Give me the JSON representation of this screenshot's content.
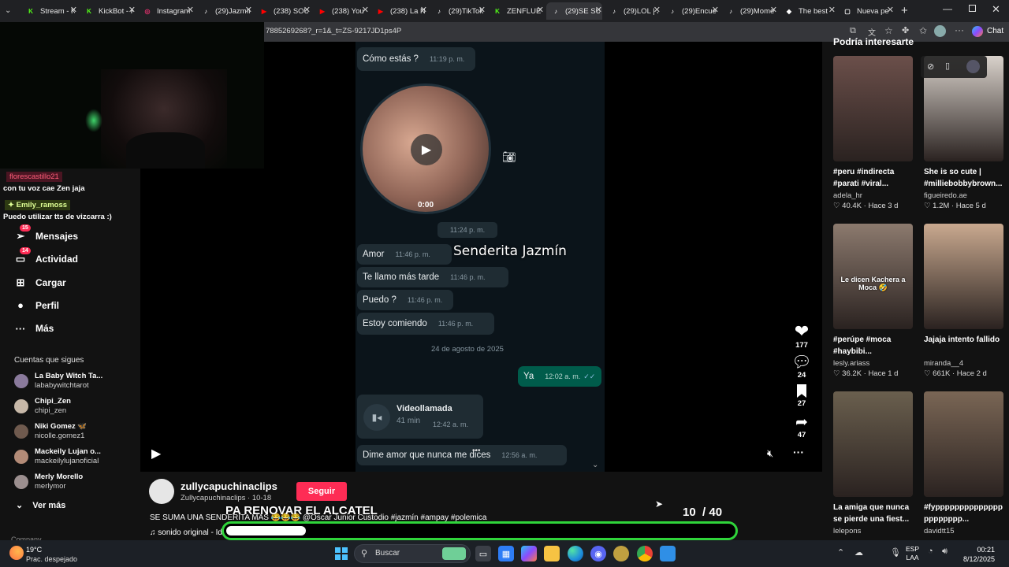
{
  "browser": {
    "tabs": [
      {
        "label": "Stream - K",
        "icon": "kick-icon",
        "color": "#53fc18"
      },
      {
        "label": "KickBot - K",
        "icon": "kick-icon",
        "color": "#53fc18"
      },
      {
        "label": "Instagram",
        "icon": "instagram-icon",
        "color": "#e1306c"
      },
      {
        "label": "(29)Jazmín",
        "icon": "tiktok-icon",
        "color": "#ffffff"
      },
      {
        "label": "(238) SOU",
        "icon": "youtube-icon",
        "color": "#ff0000"
      },
      {
        "label": "(238) You",
        "icon": "youtube-icon",
        "color": "#ff0000"
      },
      {
        "label": "(238) La N",
        "icon": "youtube-icon",
        "color": "#ff0000"
      },
      {
        "label": "(29)TikTok",
        "icon": "tiktok-icon",
        "color": "#ffffff"
      },
      {
        "label": "ZENFLUEN",
        "icon": "kick-icon",
        "color": "#53fc18"
      },
      {
        "label": "(29)SE SUM",
        "icon": "tiktok-icon",
        "color": "#ffffff"
      },
      {
        "label": "(29)LOL | J",
        "icon": "tiktok-icon",
        "color": "#ffffff"
      },
      {
        "label": "(29)Encue",
        "icon": "tiktok-icon",
        "color": "#ffffff"
      },
      {
        "label": "(29)Mome",
        "icon": "tiktok-icon",
        "color": "#ffffff"
      },
      {
        "label": "The best",
        "icon": "diamond-icon",
        "color": "#ffffff"
      },
      {
        "label": "Nueva pe",
        "icon": "newtab-icon",
        "color": "#ffffff"
      }
    ],
    "url": "7885269268?_r=1&_t=ZS-9217JD1ps4P",
    "copilot_label": "Chat"
  },
  "stream_overlay": {
    "chat": [
      {
        "user": "florescastillo21",
        "message": "con tu voz cae Zen jaja"
      },
      {
        "user": "Emily_ramoss",
        "message": "Puedo utilizar tts de vizcarra :)"
      }
    ],
    "goal_title": "PA RENOVAR EL ALCATEL",
    "goal_current": "10",
    "goal_total": "/ 40",
    "goal_progress": 0.25
  },
  "sidebar": {
    "nav": [
      {
        "label": "Mensajes",
        "badge": "15",
        "icon": "send-icon"
      },
      {
        "label": "Actividad",
        "badge": "14",
        "icon": "inbox-icon"
      },
      {
        "label": "Cargar",
        "badge": "",
        "icon": "upload-icon"
      },
      {
        "label": "Perfil",
        "badge": "",
        "icon": "profile-icon"
      },
      {
        "label": "Más",
        "badge": "",
        "icon": "more-icon"
      }
    ],
    "following_header": "Cuentas que sigues",
    "following": [
      {
        "name": "La Baby Witch Ta...",
        "handle": "lababywitchtarot"
      },
      {
        "name": "Chipi_Zen",
        "handle": "chipi_zen"
      },
      {
        "name": "Niki Gomez 🦋",
        "handle": "nicolle.gomez1"
      },
      {
        "name": "Mackeily Lujan o...",
        "handle": "mackeilylujanoficial"
      },
      {
        "name": "Merly Morello",
        "handle": "merlymor"
      }
    ],
    "see_more": "Ver más",
    "company": "Company"
  },
  "video": {
    "overlay_name": "Senderita Jazmín",
    "voice_time": "0:00",
    "messages": [
      {
        "text": "Cómo estás ?",
        "time": "11:19 p. m."
      },
      {
        "text": "11:24 p. m.",
        "time": ""
      },
      {
        "text": "Amor",
        "time": "11:46 p. m."
      },
      {
        "text": "Te llamo más tarde",
        "time": "11:46 p. m."
      },
      {
        "text": "Puedo ?",
        "time": "11:46 p. m."
      },
      {
        "text": "Estoy comiendo",
        "time": "11:46 p. m."
      }
    ],
    "date_divider": "24 de agosto de 2025",
    "sent": {
      "text": "Ya",
      "time": "12:02 a. m."
    },
    "call": {
      "title": "Videollamada",
      "duration": "41 min",
      "time": "12:42 a. m."
    },
    "last": {
      "text": "Dime amor que nunca me dices",
      "time": "12:56 a. m."
    },
    "likes": "177",
    "comments": "24",
    "saves": "27",
    "shares": "47"
  },
  "post": {
    "username": "zullycapuchinaclips",
    "meta": "Zullycapuchinaclips · 10-18",
    "follow_label": "Seguir",
    "caption": "SE SUMA UNA SENDERITA MÁS 😂😂😂 @Oscar Junior Custodio #jazmín #ampay #polemica",
    "sound": "♫ sonido original - Id"
  },
  "recommendations": {
    "header": "Podría interesarte",
    "cards": [
      {
        "caption": "#peru #indirecta #parati #viral...",
        "author": "adela_hr",
        "likes": "40.4K",
        "age": "Hace 3 d",
        "tone": "#6b4f4a"
      },
      {
        "caption": "She is so cute | #milliebobbybrown...",
        "author": "figueiredo.ae",
        "likes": "1.2M",
        "age": "Hace 5 d",
        "tone": "#d9d2cb"
      },
      {
        "caption": "#perúpe #moca #haybibi...",
        "author": "lesly.ariass",
        "likes": "36.2K",
        "age": "Hace 1 d",
        "tone": "#8c7a6e",
        "overlay": "Le dicen Kachera a Moca 🤣"
      },
      {
        "caption": "Jajaja intento fallido",
        "author": "miranda__4",
        "likes": "661K",
        "age": "Hace 2 d",
        "tone": "#c9a98f"
      },
      {
        "caption": "La amiga que nunca se pierde una fiest...",
        "author": "lelepons",
        "likes": "",
        "age": "",
        "tone": "#6a5f4e"
      },
      {
        "caption": "#fypppppppppppppp pppppppp...",
        "author": "davidtt15",
        "likes": "",
        "age": "",
        "tone": "#7a6655"
      }
    ]
  },
  "taskbar": {
    "weather_temp": "19°C",
    "weather_desc": "Prac. despejado",
    "search_placeholder": "Buscar",
    "lang": "ESP",
    "lang2": "LAA",
    "time": "00:21",
    "date": "8/12/2025"
  },
  "colors": {
    "tiktok_red": "#fe2c55",
    "goal_green": "#2fd43a",
    "wa_sent": "#005c4b",
    "wa_bubble": "#1f2c33"
  }
}
